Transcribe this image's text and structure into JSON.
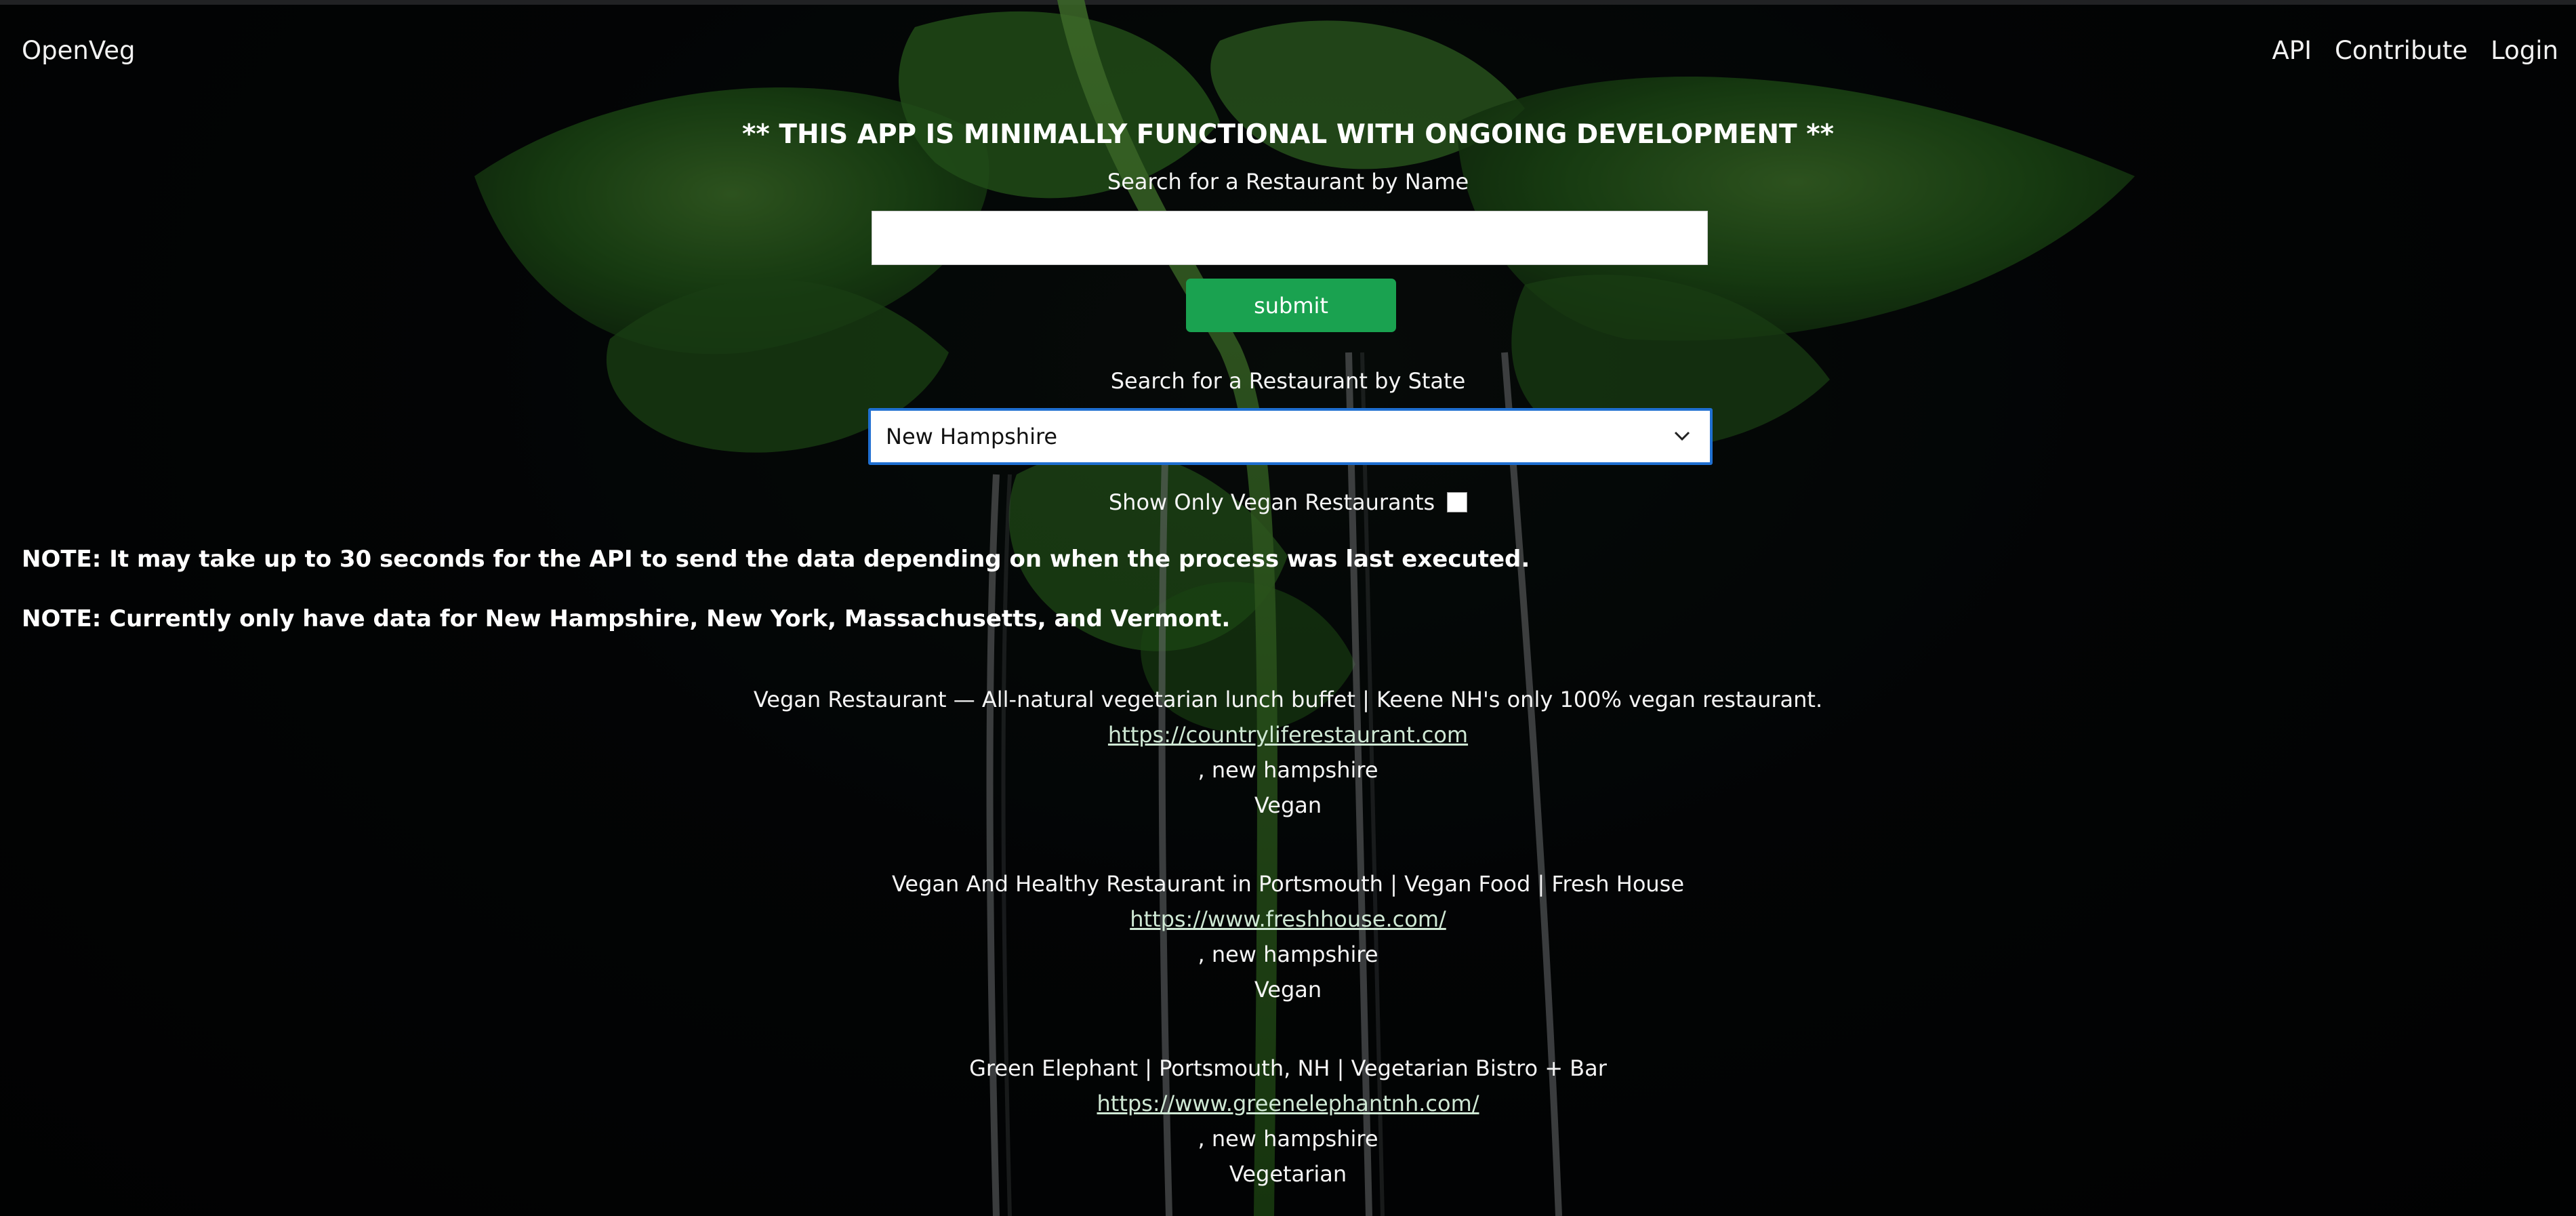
{
  "nav": {
    "brand": "OpenVeg",
    "links": [
      "API",
      "Contribute",
      "Login"
    ]
  },
  "banner": "** THIS APP IS MINIMALLY FUNCTIONAL WITH ONGOING DEVELOPMENT **",
  "search_by_name": {
    "label": "Search for a Restaurant by Name",
    "value": "",
    "submit_label": "submit"
  },
  "search_by_state": {
    "label": "Search for a Restaurant by State",
    "selected": "New Hampshire"
  },
  "vegan_filter": {
    "label": "Show Only Vegan Restaurants",
    "checked": false
  },
  "notes": [
    "NOTE: It may take up to 30 seconds for the API to send the data depending on when the process was last executed.",
    "NOTE: Currently only have data for New Hampshire, New York, Massachusetts, and Vermont."
  ],
  "results": [
    {
      "title": "Vegan Restaurant — All-natural vegetarian lunch buffet | Keene NH's only 100% vegan restaurant.",
      "url": "https://countryliferestaurant.com",
      "location": ", new hampshire",
      "type": "Vegan"
    },
    {
      "title": "Vegan And Healthy Restaurant in Portsmouth | Vegan Food | Fresh House",
      "url": "https://www.freshhouse.com/",
      "location": ", new hampshire",
      "type": "Vegan"
    },
    {
      "title": "Green Elephant | Portsmouth, NH | Vegetarian Bistro + Bar",
      "url": "https://www.greenelephantnh.com/",
      "location": ", new hampshire",
      "type": "Vegetarian"
    }
  ],
  "colors": {
    "submit_green": "#1aa250",
    "select_border": "#1f6fd1",
    "leaf_green": "#3f8a2e",
    "background": "#050607"
  }
}
